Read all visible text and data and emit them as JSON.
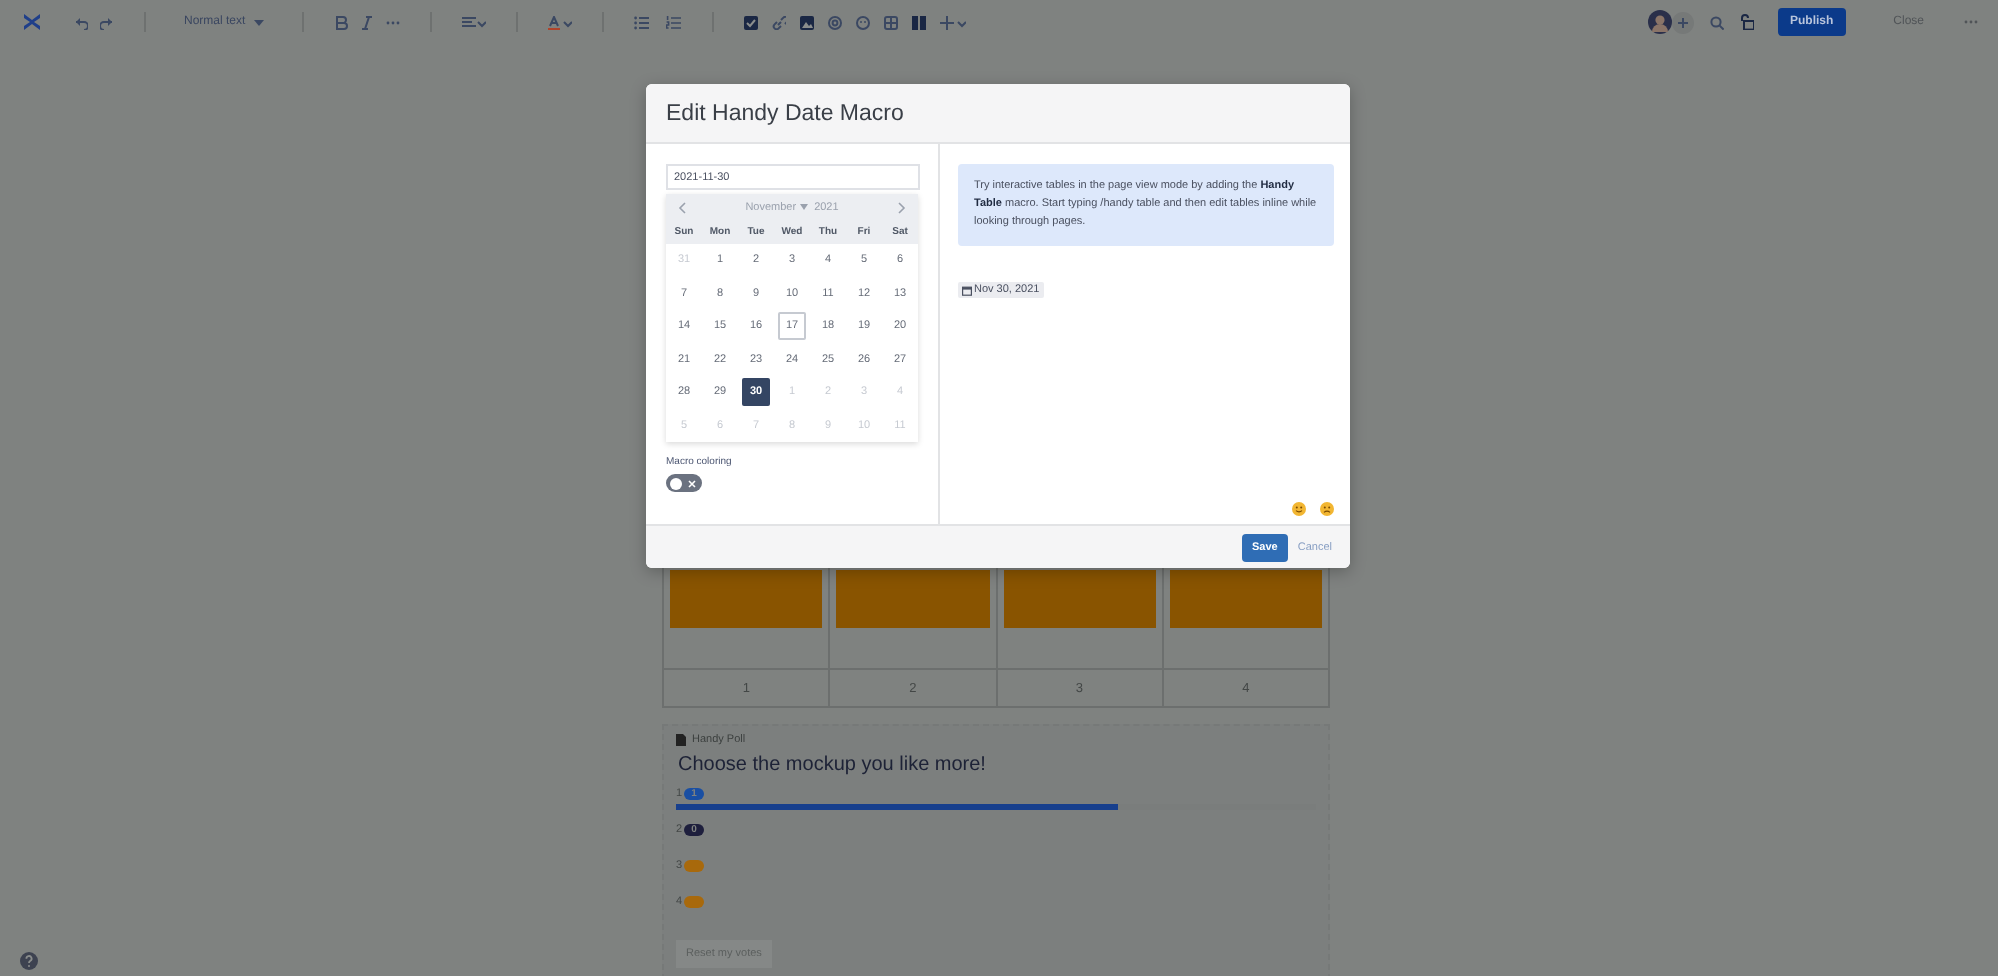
{
  "toolbar": {
    "text_style": "Normal text",
    "publish": "Publish",
    "close": "Close"
  },
  "dialog": {
    "title": "Edit Handy Date Macro",
    "date_value": "2021-11-30",
    "calendar": {
      "month": "November",
      "year": "2021",
      "weekdays": [
        "Sun",
        "Mon",
        "Tue",
        "Wed",
        "Thu",
        "Fri",
        "Sat"
      ],
      "weeks": [
        [
          {
            "day": "31",
            "outside": true,
            "today": false,
            "selected": false
          },
          {
            "day": "1",
            "outside": false,
            "today": false,
            "selected": false
          },
          {
            "day": "2",
            "outside": false,
            "today": false,
            "selected": false
          },
          {
            "day": "3",
            "outside": false,
            "today": false,
            "selected": false
          },
          {
            "day": "4",
            "outside": false,
            "today": false,
            "selected": false
          },
          {
            "day": "5",
            "outside": false,
            "today": false,
            "selected": false
          },
          {
            "day": "6",
            "outside": false,
            "today": false,
            "selected": false
          }
        ],
        [
          {
            "day": "7",
            "outside": false,
            "today": false,
            "selected": false
          },
          {
            "day": "8",
            "outside": false,
            "today": false,
            "selected": false
          },
          {
            "day": "9",
            "outside": false,
            "today": false,
            "selected": false
          },
          {
            "day": "10",
            "outside": false,
            "today": false,
            "selected": false
          },
          {
            "day": "11",
            "outside": false,
            "today": false,
            "selected": false
          },
          {
            "day": "12",
            "outside": false,
            "today": false,
            "selected": false
          },
          {
            "day": "13",
            "outside": false,
            "today": false,
            "selected": false
          }
        ],
        [
          {
            "day": "14",
            "outside": false,
            "today": false,
            "selected": false
          },
          {
            "day": "15",
            "outside": false,
            "today": false,
            "selected": false
          },
          {
            "day": "16",
            "outside": false,
            "today": false,
            "selected": false
          },
          {
            "day": "17",
            "outside": false,
            "today": true,
            "selected": false
          },
          {
            "day": "18",
            "outside": false,
            "today": false,
            "selected": false
          },
          {
            "day": "19",
            "outside": false,
            "today": false,
            "selected": false
          },
          {
            "day": "20",
            "outside": false,
            "today": false,
            "selected": false
          }
        ],
        [
          {
            "day": "21",
            "outside": false,
            "today": false,
            "selected": false
          },
          {
            "day": "22",
            "outside": false,
            "today": false,
            "selected": false
          },
          {
            "day": "23",
            "outside": false,
            "today": false,
            "selected": false
          },
          {
            "day": "24",
            "outside": false,
            "today": false,
            "selected": false
          },
          {
            "day": "25",
            "outside": false,
            "today": false,
            "selected": false
          },
          {
            "day": "26",
            "outside": false,
            "today": false,
            "selected": false
          },
          {
            "day": "27",
            "outside": false,
            "today": false,
            "selected": false
          }
        ],
        [
          {
            "day": "28",
            "outside": false,
            "today": false,
            "selected": false
          },
          {
            "day": "29",
            "outside": false,
            "today": false,
            "selected": false
          },
          {
            "day": "30",
            "outside": false,
            "today": false,
            "selected": true
          },
          {
            "day": "1",
            "outside": true,
            "today": false,
            "selected": false
          },
          {
            "day": "2",
            "outside": true,
            "today": false,
            "selected": false
          },
          {
            "day": "3",
            "outside": true,
            "today": false,
            "selected": false
          },
          {
            "day": "4",
            "outside": true,
            "today": false,
            "selected": false
          }
        ],
        [
          {
            "day": "5",
            "outside": true,
            "today": false,
            "selected": false
          },
          {
            "day": "6",
            "outside": true,
            "today": false,
            "selected": false
          },
          {
            "day": "7",
            "outside": true,
            "today": false,
            "selected": false
          },
          {
            "day": "8",
            "outside": true,
            "today": false,
            "selected": false
          },
          {
            "day": "9",
            "outside": true,
            "today": false,
            "selected": false
          },
          {
            "day": "10",
            "outside": true,
            "today": false,
            "selected": false
          },
          {
            "day": "11",
            "outside": true,
            "today": false,
            "selected": false
          }
        ]
      ]
    },
    "macro_coloring": {
      "label": "Macro coloring",
      "on": false
    },
    "info": "Try interactive tables in the page view mode by adding the **Handy Table** macro. Start typing /handy  table and then edit tables inline while looking through pages.",
    "date_badge": "Nov 30, 2021",
    "save": "Save",
    "cancel": "Cancel"
  },
  "table": {
    "columns": [
      "1",
      "2",
      "3",
      "4"
    ]
  },
  "poll": {
    "header": "Handy Poll",
    "question": "Choose the mockup you like more!",
    "options": [
      {
        "label": "1",
        "count": "1",
        "color": "#1a4fa3",
        "level": 0.69
      },
      {
        "label": "2",
        "count": "0",
        "color": "#1e1f3d"
      },
      {
        "label": "3",
        "color": "#a8690c"
      },
      {
        "label": "4",
        "color": "#a8690c"
      }
    ],
    "reset": "Reset my votes"
  }
}
